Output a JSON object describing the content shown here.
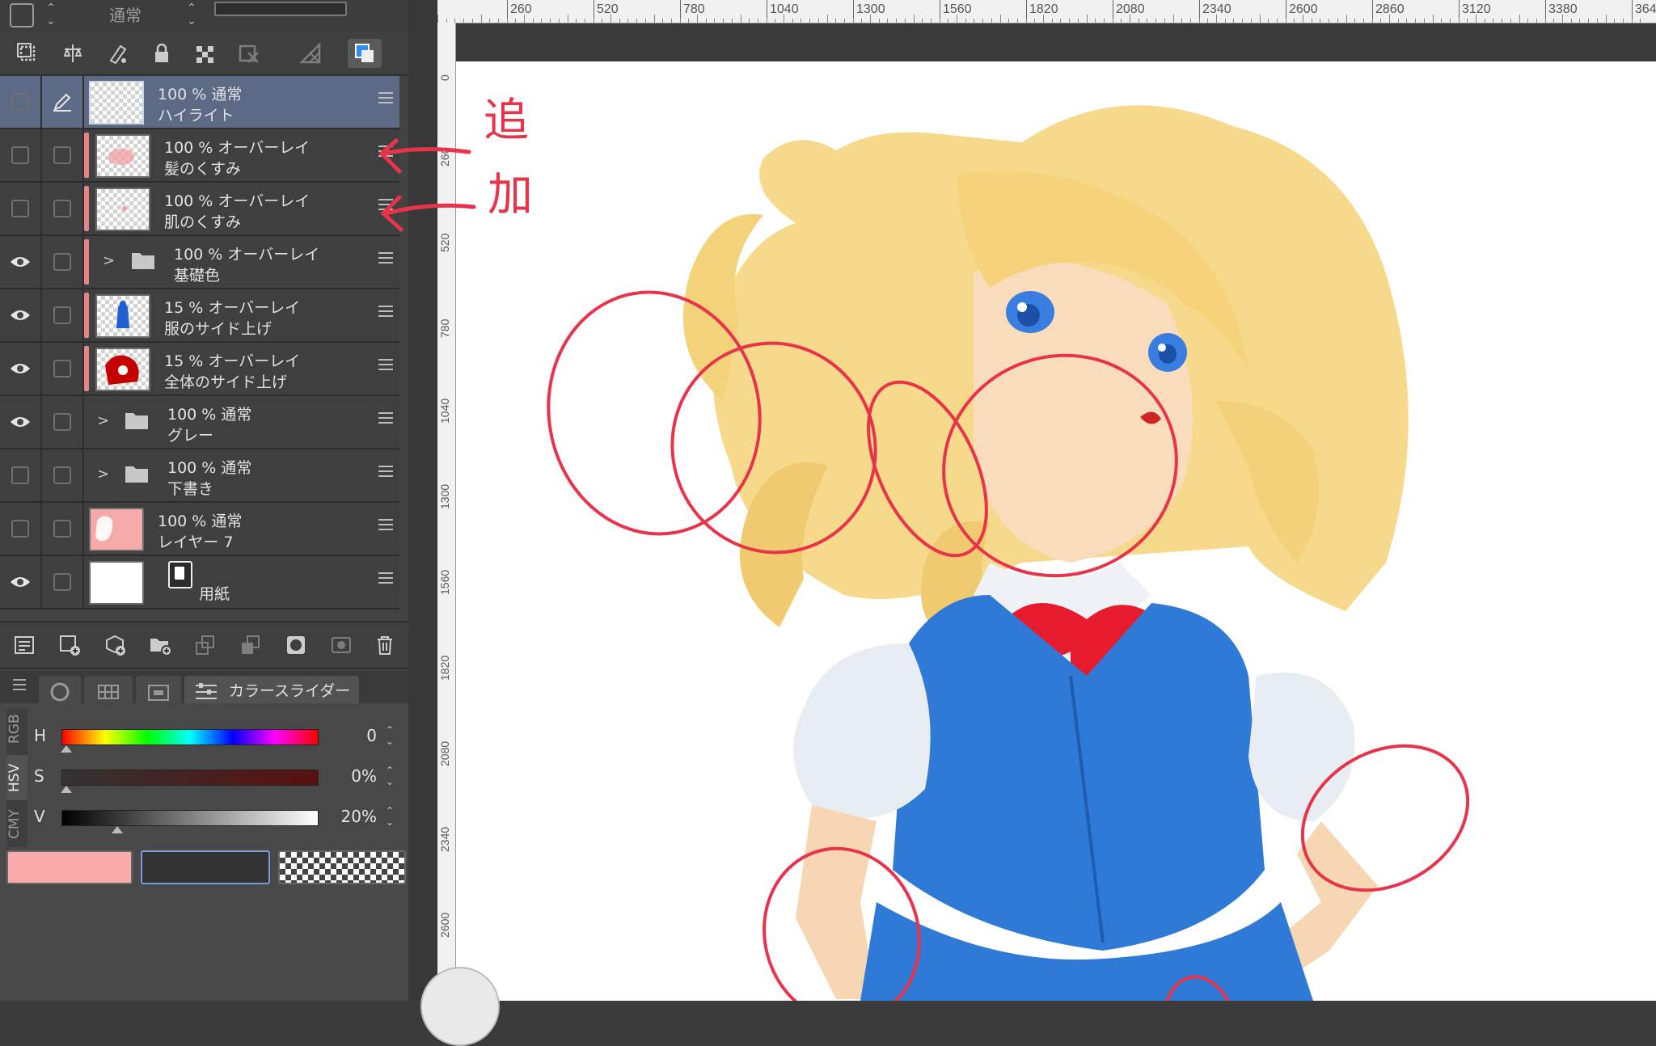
{
  "blend": {
    "mode_label": "通常"
  },
  "layers": [
    {
      "opacity": "100 %",
      "mode": "通常",
      "name": "ハイライト",
      "visible": false,
      "selected": true
    },
    {
      "opacity": "100 %",
      "mode": "オーバーレイ",
      "name": "髪のくすみ",
      "visible": false
    },
    {
      "opacity": "100 %",
      "mode": "オーバーレイ",
      "name": "肌のくすみ",
      "visible": false
    },
    {
      "opacity": "100 %",
      "mode": "オーバーレイ",
      "name": "基礎色",
      "visible": true,
      "folder": true
    },
    {
      "opacity": "15 %",
      "mode": "オーバーレイ",
      "name": "服のサイド上げ",
      "visible": true
    },
    {
      "opacity": "15 %",
      "mode": "オーバーレイ",
      "name": "全体のサイド上げ",
      "visible": true
    },
    {
      "opacity": "100 %",
      "mode": "通常",
      "name": "グレー",
      "visible": true,
      "folder": true
    },
    {
      "opacity": "100 %",
      "mode": "通常",
      "name": "下書き",
      "visible": false,
      "folder": true
    },
    {
      "opacity": "100 %",
      "mode": "通常",
      "name": "レイヤー 7",
      "visible": false
    },
    {
      "opacity": "",
      "mode": "",
      "name": "用紙",
      "visible": true
    }
  ],
  "color_panel": {
    "tab_label": "カラースライダー",
    "modes": [
      "RGB",
      "HSV",
      "CMY"
    ],
    "active_mode": "HSV",
    "sliders": [
      {
        "label": "H",
        "value": "0",
        "level": 0
      },
      {
        "label": "S",
        "value": "0%",
        "level": 0
      },
      {
        "label": "V",
        "value": "20%",
        "level": 0.2
      }
    ],
    "colors": {
      "main": "#f7a8a8",
      "sub": "#333333"
    }
  },
  "ruler": {
    "top_labels": [
      "260",
      "520",
      "780",
      "1040",
      "1300",
      "1560",
      "1820",
      "2080",
      "2340",
      "2600",
      "2860",
      "3120",
      "3380",
      "364"
    ],
    "left_labels": [
      "0",
      "260",
      "520",
      "780",
      "1040",
      "1300",
      "1560",
      "1820",
      "2080",
      "2340",
      "2600"
    ]
  },
  "annotation": {
    "char1": "追",
    "char2": "加"
  }
}
